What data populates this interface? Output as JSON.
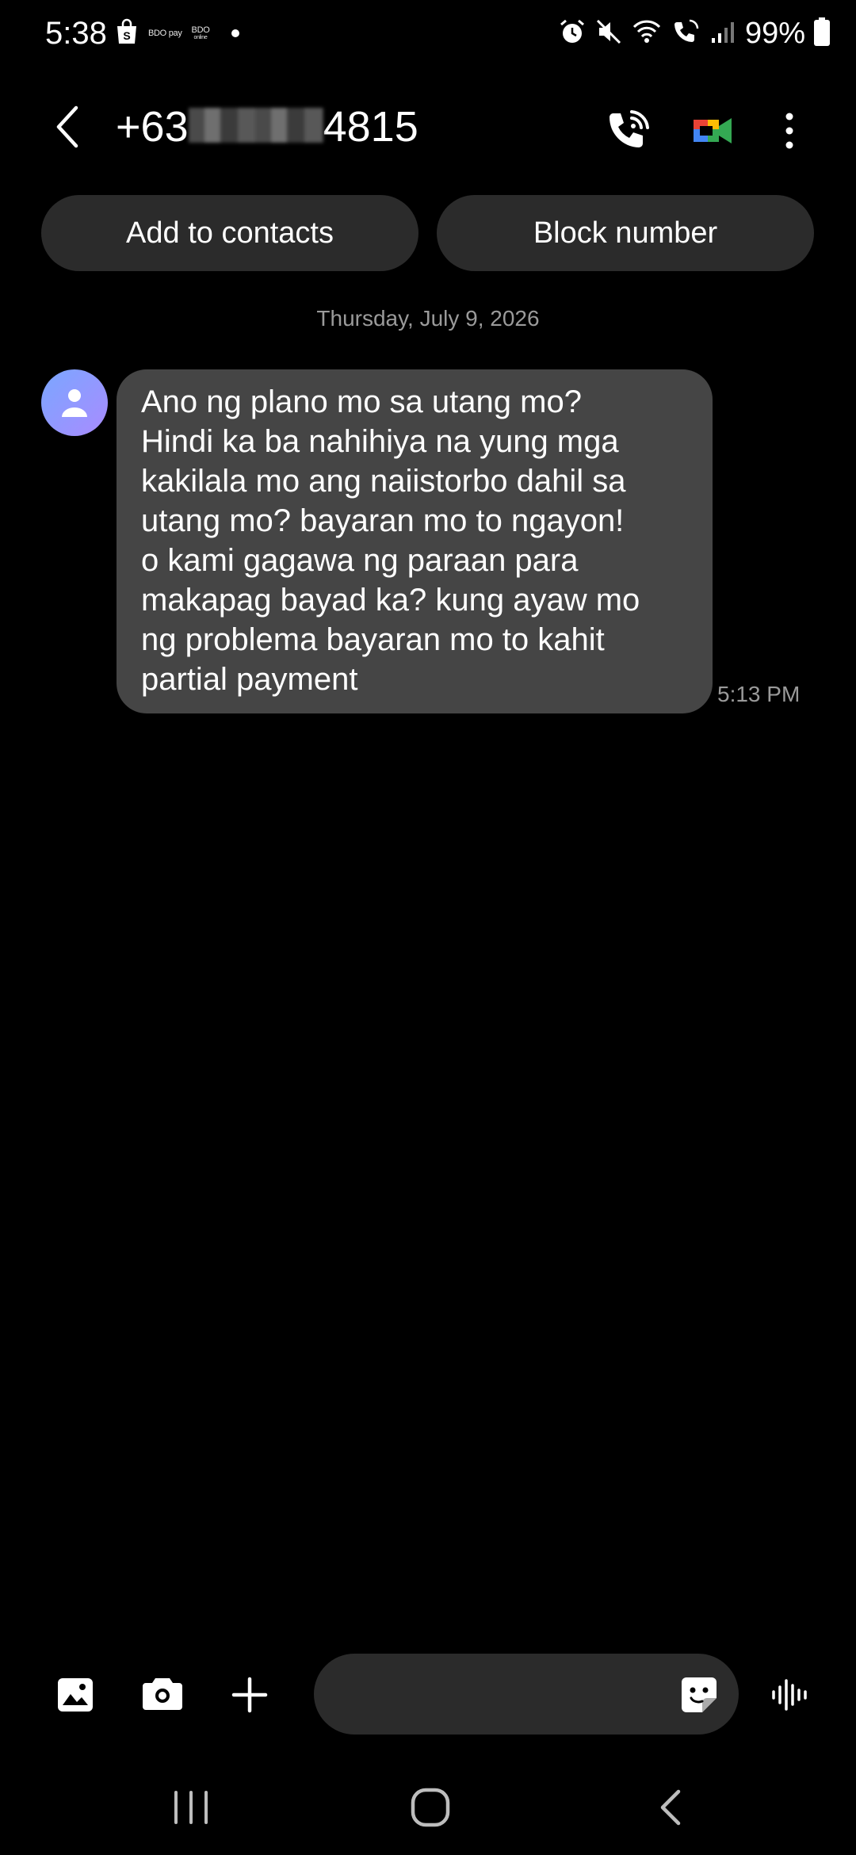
{
  "status_bar": {
    "time": "5:38",
    "battery": "99%",
    "notifications": [
      {
        "icon": "shopee-bag-icon"
      },
      {
        "icon": "bdo-pay-icon",
        "label": "BDO pay"
      },
      {
        "icon": "bdo-online-icon",
        "label": "BDO",
        "sublabel": "online"
      }
    ],
    "indicators": [
      "alarm-icon",
      "mute-icon",
      "wifi-icon",
      "wifi-calling-icon",
      "signal-icon",
      "battery-icon"
    ]
  },
  "header": {
    "number_prefix": "+63",
    "number_suffix": "4815",
    "icons": {
      "back": "chevron-left-icon",
      "call": "phone-call-icon",
      "video": "video-call-icon",
      "more": "more-vertical-icon"
    }
  },
  "actions": {
    "add_contact": "Add to contacts",
    "block": "Block number"
  },
  "conversation": {
    "date": "Thursday, July 9, 2026",
    "messages": [
      {
        "direction": "incoming",
        "text": "Ano ng plano mo sa utang mo?\nHindi ka ba nahihiya na yung mga\nkakilala mo ang naiistorbo dahil sa\nutang mo? bayaran mo  to ngayon!\no kami gagawa ng paraan para\nmakapag bayad ka? kung ayaw mo\nng problema bayaran mo to kahit\npartial payment",
        "time": "5:13 PM"
      }
    ]
  },
  "compose": {
    "placeholder": "",
    "icons": [
      "gallery-icon",
      "camera-icon",
      "plus-icon",
      "sticker-icon",
      "voice-wave-icon"
    ]
  },
  "colors": {
    "background": "#000000",
    "bubble": "#454545",
    "pill": "#2b2b2b",
    "muted_text": "#9a9a9a"
  }
}
